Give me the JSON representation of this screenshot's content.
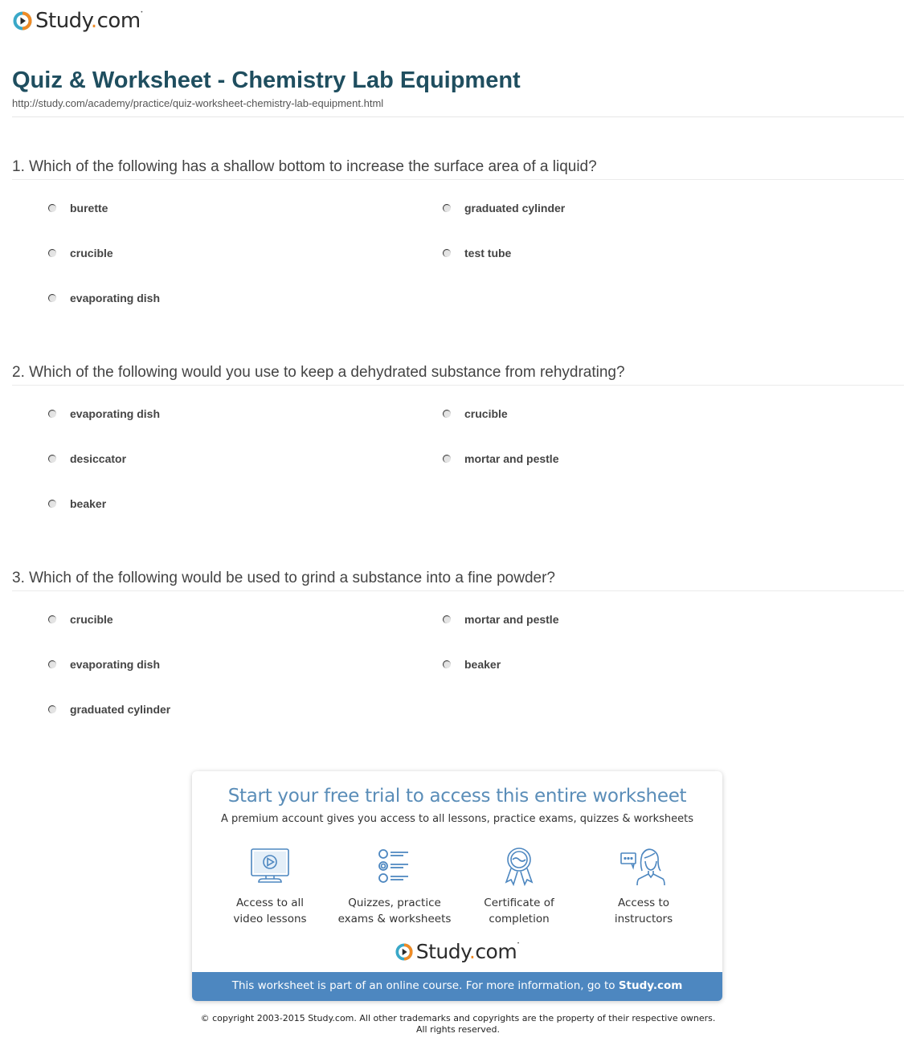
{
  "brand": {
    "name_part1": "Study",
    "name_dot": ".",
    "name_part2": "com",
    "colors": {
      "orange": "#f08a24",
      "teal": "#3aa8c8",
      "dark": "#2b2b2b",
      "title": "#1f4e5f",
      "accent_blue": "#4d87c0"
    }
  },
  "header": {
    "title": "Quiz & Worksheet - Chemistry Lab Equipment",
    "url": "http://study.com/academy/practice/quiz-worksheet-chemistry-lab-equipment.html"
  },
  "questions": [
    {
      "text": "1. Which of the following has a shallow bottom to increase the surface area of a liquid?",
      "options": [
        "burette",
        "graduated cylinder",
        "crucible",
        "test tube",
        "evaporating dish"
      ]
    },
    {
      "text": "2. Which of the following would you use to keep a dehydrated substance from rehydrating?",
      "options": [
        "evaporating dish",
        "crucible",
        "desiccator",
        "mortar and pestle",
        "beaker"
      ]
    },
    {
      "text": "3. Which of the following would be used to grind a substance into a fine powder?",
      "options": [
        "crucible",
        "mortar and pestle",
        "evaporating dish",
        "beaker",
        "graduated cylinder"
      ]
    }
  ],
  "promo": {
    "title": "Start your free trial to access this entire worksheet",
    "subtitle": "A premium account gives you access to all lessons, practice exams, quizzes & worksheets",
    "features": [
      {
        "icon": "video-monitor-icon",
        "line1": "Access to all",
        "line2": "video lessons"
      },
      {
        "icon": "quiz-list-icon",
        "line1": "Quizzes, practice",
        "line2": "exams & worksheets"
      },
      {
        "icon": "certificate-ribbon-icon",
        "line1": "Certificate of",
        "line2": "completion"
      },
      {
        "icon": "instructor-chat-icon",
        "line1": "Access to",
        "line2": "instructors"
      }
    ],
    "bar_text": "This worksheet is part of an online course. For more information, go to ",
    "bar_link": "Study.com"
  },
  "footer": {
    "copyright_line1": "© copyright 2003-2015 Study.com. All other trademarks and copyrights are the property of their respective owners.",
    "copyright_line2": "All rights reserved."
  }
}
